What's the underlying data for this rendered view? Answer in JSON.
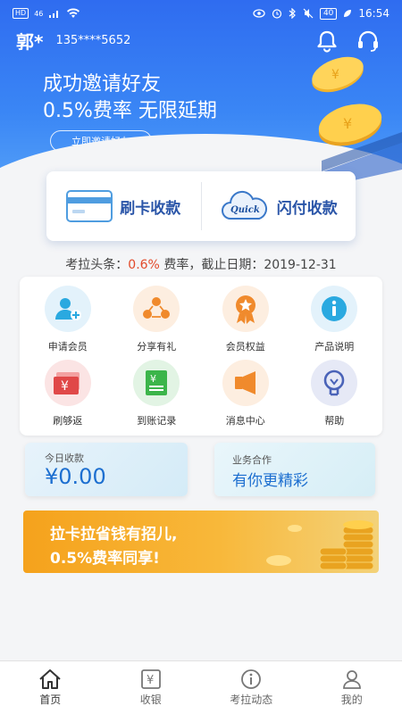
{
  "status_bar": {
    "left_badges": [
      "HD",
      "46"
    ],
    "time": "16:54",
    "battery": "40"
  },
  "user": {
    "name": "郭*",
    "phone": "135****5652"
  },
  "header_icons": [
    "bell-icon",
    "headset-icon"
  ],
  "banner": {
    "line1": "成功邀请好友",
    "line2": "0.5%费率 无限延期",
    "button_label": "立即邀请好友"
  },
  "pay_options": [
    {
      "label": "刷卡收款",
      "icon": "bank-card-icon"
    },
    {
      "label": "闪付收款",
      "icon": "quickpass-cloud-icon",
      "icon_text": "Quick"
    }
  ],
  "news": {
    "prefix": "考拉头条：",
    "rate": "0.6%",
    "middle": " 费率，截止日期：",
    "date": "2019-12-31"
  },
  "grid_items": [
    {
      "label": "申请会员",
      "icon": "add-user-icon",
      "color": "#2aa9e0"
    },
    {
      "label": "分享有礼",
      "icon": "share-people-icon",
      "color": "#f08a2c"
    },
    {
      "label": "会员权益",
      "icon": "medal-icon",
      "color": "#f08a2c"
    },
    {
      "label": "产品说明",
      "icon": "info-icon",
      "color": "#2aa9e0"
    },
    {
      "label": "刷够返",
      "icon": "cash-back-icon",
      "color": "#e04848"
    },
    {
      "label": "到账记录",
      "icon": "receipt-icon",
      "color": "#3bb54a"
    },
    {
      "label": "消息中心",
      "icon": "message-icon",
      "color": "#f08a2c"
    },
    {
      "label": "帮助",
      "icon": "help-bulb-icon",
      "color": "#4a63b8"
    }
  ],
  "today_card": {
    "title": "今日收款",
    "value": "¥0.00"
  },
  "biz_card": {
    "title": "业务合作",
    "value": "有你更精彩"
  },
  "promo": {
    "line1": "拉卡拉省钱有招儿,",
    "line2": "0.5%费率同享!"
  },
  "tabs": [
    {
      "label": "首页",
      "icon": "home-icon",
      "active": true
    },
    {
      "label": "收银",
      "icon": "cashier-icon",
      "active": false
    },
    {
      "label": "考拉动态",
      "icon": "info-circle-icon",
      "active": false
    },
    {
      "label": "我的",
      "icon": "profile-icon",
      "active": false
    }
  ],
  "colors": {
    "primary_blue": "#2f6cf0",
    "accent_red": "#e24a2a",
    "value_blue": "#1d6fd0",
    "promo_orange": "#f5a21c"
  }
}
